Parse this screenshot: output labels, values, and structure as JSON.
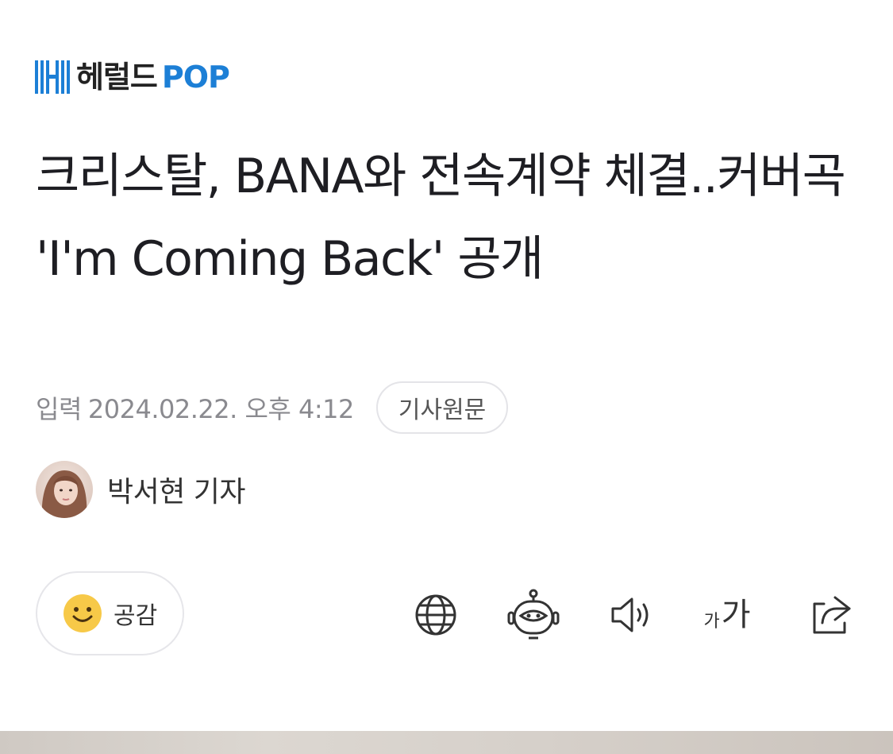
{
  "publisher": {
    "name": "헤럴드",
    "name_suffix": "POP",
    "brand_color": "#1c7fd6"
  },
  "article": {
    "headline": "크리스탈, BANA와 전속계약 체결..커버곡 'I'm Coming Back' 공개",
    "published_label": "입력",
    "published_at": "2024.02.22. 오후 4:12",
    "original_link_label": "기사원문"
  },
  "author": {
    "name": "박서현 기자"
  },
  "actions": {
    "empathy_label": "공감",
    "icons": [
      "globe-icon",
      "robot-summary-icon",
      "speaker-icon",
      "font-size-icon",
      "share-icon"
    ],
    "font_small": "가",
    "font_big": "가"
  }
}
